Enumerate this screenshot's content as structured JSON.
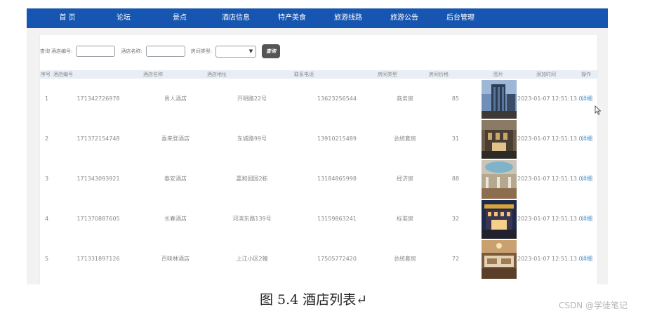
{
  "nav": {
    "items": [
      "首 页",
      "论坛",
      "景点",
      "酒店信息",
      "特产美食",
      "旅游线路",
      "旅游公告",
      "后台管理"
    ]
  },
  "search": {
    "prefix": "查询",
    "hotel_code_label": "酒店编号:",
    "hotel_name_label": "酒店名称:",
    "room_type_label": "房间类型:",
    "button_label": "查询"
  },
  "table": {
    "headers": [
      "序号",
      "酒店编号",
      "酒店名称",
      "酒店地址",
      "联系电话",
      "房间类型",
      "房间价格",
      "图片",
      "添加时间",
      "操作"
    ],
    "rows": [
      {
        "index": "1",
        "code": "171342726978",
        "name": "贵人酒店",
        "address": "开明路22号",
        "phone": "13623256544",
        "room_type": "商务房",
        "price": "85",
        "time": "2023-01-07 12:51:13.0",
        "action": "详细"
      },
      {
        "index": "2",
        "code": "171372154748",
        "name": "喜来登酒店",
        "address": "东城路99号",
        "phone": "13910215489",
        "room_type": "总统套房",
        "price": "31",
        "time": "2023-01-07 12:51:13.0",
        "action": "详细"
      },
      {
        "index": "3",
        "code": "171343093921",
        "name": "泰安酒店",
        "address": "嘉和园园2栋",
        "phone": "13184865998",
        "room_type": "经济房",
        "price": "88",
        "time": "2023-01-07 12:51:13.0",
        "action": "详细"
      },
      {
        "index": "4",
        "code": "171370887605",
        "name": "长春酒店",
        "address": "河滨东路139号",
        "phone": "13159863241",
        "room_type": "标准房",
        "price": "32",
        "time": "2023-01-07 12:51:13.0",
        "action": "详细"
      },
      {
        "index": "5",
        "code": "171331897126",
        "name": "百味林酒店",
        "address": "上江小区2幢",
        "phone": "17505772420",
        "room_type": "总统套房",
        "price": "72",
        "time": "2023-01-07 12:51:13.0",
        "action": "详细"
      }
    ]
  },
  "caption": "图 5.4  酒店列表↵",
  "watermark": "CSDN @学徒笔记",
  "colors": {
    "nav_bg": "#1655b0",
    "link": "#3d8ed0",
    "header_bg": "#e8eef5"
  },
  "icons": {
    "cursor": "mouse-pointer-icon",
    "select_caret": "chevron-down-icon"
  }
}
